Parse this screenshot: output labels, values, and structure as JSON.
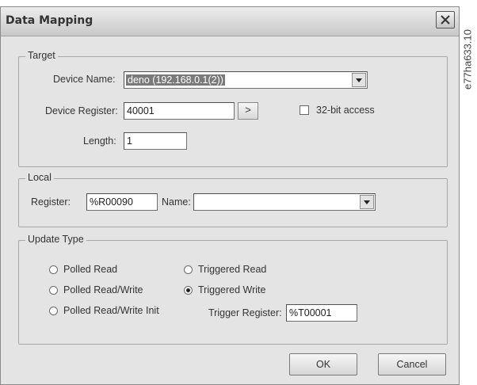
{
  "window": {
    "title": "Data Mapping"
  },
  "figure_id": "e77ha633.10",
  "target": {
    "legend": "Target",
    "device_name_label": "Device Name:",
    "device_name_value": "deno (192.168.0.1(2))",
    "device_register_label": "Device Register:",
    "device_register_value": "40001",
    "arrow_label": ">",
    "bit_access_label": "32-bit access",
    "bit_access_checked": false,
    "length_label": "Length:",
    "length_value": "1"
  },
  "local": {
    "legend": "Local",
    "register_label": "Register:",
    "register_value": "%R00090",
    "name_label": "Name:",
    "name_value": ""
  },
  "update_type": {
    "legend": "Update Type",
    "options": [
      {
        "label": "Polled Read",
        "selected": false
      },
      {
        "label": "Polled Read/Write",
        "selected": false
      },
      {
        "label": "Polled Read/Write Init",
        "selected": false
      },
      {
        "label": "Triggered Read",
        "selected": false
      },
      {
        "label": "Triggered Write",
        "selected": true
      }
    ],
    "trigger_register_label": "Trigger Register:",
    "trigger_register_value": "%T00001"
  },
  "buttons": {
    "ok": "OK",
    "cancel": "Cancel"
  }
}
